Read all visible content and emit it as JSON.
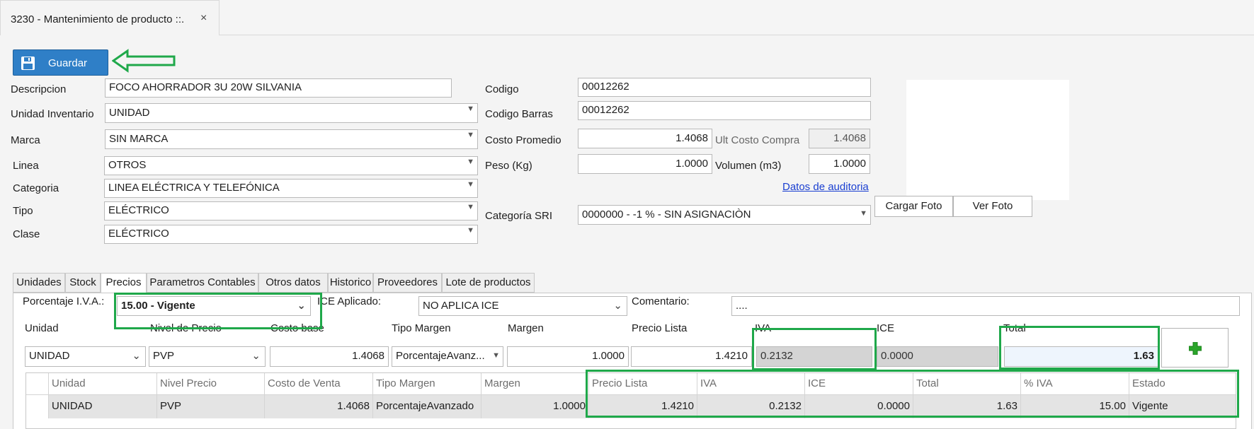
{
  "window": {
    "tab_title": "3230 - Mantenimiento de producto ::.",
    "close_symbol": "×"
  },
  "toolbar": {
    "save_label": "Guardar",
    "save_icon": "floppy-disk-icon"
  },
  "form": {
    "descripcion_label": "Descripcion",
    "descripcion_value": "FOCO AHORRADOR 3U 20W SILVANIA",
    "unidad_inventario_label": "Unidad Inventario",
    "unidad_inventario_value": "UNIDAD",
    "marca_label": "Marca",
    "marca_value": "SIN MARCA",
    "linea_label": "Linea",
    "linea_value": "OTROS",
    "categoria_label": "Categoria",
    "categoria_value": "LINEA ELÉCTRICA Y TELEFÓNICA",
    "tipo_label": "Tipo",
    "tipo_value": "ELÉCTRICO",
    "clase_label": "Clase",
    "clase_value": "ELÉCTRICO",
    "codigo_label": "Codigo",
    "codigo_value": "00012262",
    "codigo_barras_label": "Codigo Barras",
    "codigo_barras_value": "00012262",
    "costo_promedio_label": "Costo Promedio",
    "costo_promedio_value": "1.4068",
    "ult_costo_compra_label": "Ult Costo Compra",
    "ult_costo_compra_value": "1.4068",
    "peso_label": "Peso (Kg)",
    "peso_value": "1.0000",
    "volumen_label": "Volumen (m3)",
    "volumen_value": "1.0000",
    "auditoria_link": "Datos de auditoria",
    "categoria_sri_label": "Categoría SRI",
    "categoria_sri_value": "0000000 - -1 % - SIN ASIGNACIÒN",
    "cargar_foto_label": "Cargar Foto",
    "ver_foto_label": "Ver Foto"
  },
  "tabs": [
    {
      "label": "Unidades"
    },
    {
      "label": "Stock"
    },
    {
      "label": "Precios"
    },
    {
      "label": "Parametros Contables"
    },
    {
      "label": "Otros datos"
    },
    {
      "label": "Historico"
    },
    {
      "label": "Proveedores"
    },
    {
      "label": "Lote de productos"
    }
  ],
  "active_tab": "Precios",
  "precios": {
    "porcentaje_iva_label": "Porcentaje I.V.A.:",
    "porcentaje_iva_value": "15.00 - Vigente",
    "ice_aplicado_label": "ICE Aplicado:",
    "ice_aplicado_value": "NO APLICA ICE",
    "comentario_label": "Comentario:",
    "comentario_value": "....",
    "unidad_label": "Unidad",
    "unidad_value": "UNIDAD",
    "nivel_precio_label": "Nivel de Precio",
    "nivel_precio_value": "PVP",
    "costo_base_label": "Costo base",
    "costo_base_value": "1.4068",
    "tipo_margen_label": "Tipo Margen",
    "tipo_margen_value": "PorcentajeAvanz...",
    "margen_label": "Margen",
    "margen_value": "1.0000",
    "precio_lista_label": "Precio Lista",
    "precio_lista_value": "1.4210",
    "iva_label": "IVA",
    "iva_value": "0.2132",
    "ice_label": "ICE",
    "ice_value": "0.0000",
    "total_label": "Total",
    "total_value": "1.63",
    "add_icon": "plus-icon"
  },
  "grid": {
    "columns": [
      "Unidad",
      "Nivel Precio",
      "Costo de Venta",
      "Tipo Margen",
      "Margen",
      "Precio Lista",
      "IVA",
      "ICE",
      "Total",
      "% IVA",
      "Estado"
    ],
    "rows": [
      [
        "UNIDAD",
        "PVP",
        "1.4068",
        "PorcentajeAvanzado",
        "1.0000",
        "1.4210",
        "0.2132",
        "0.0000",
        "1.63",
        "15.00",
        "Vigente"
      ]
    ]
  },
  "colors": {
    "accent": "#2f7fc7",
    "highlight": "#1fa84a",
    "link": "#1a3fd1",
    "plus": "#2aa52a"
  }
}
